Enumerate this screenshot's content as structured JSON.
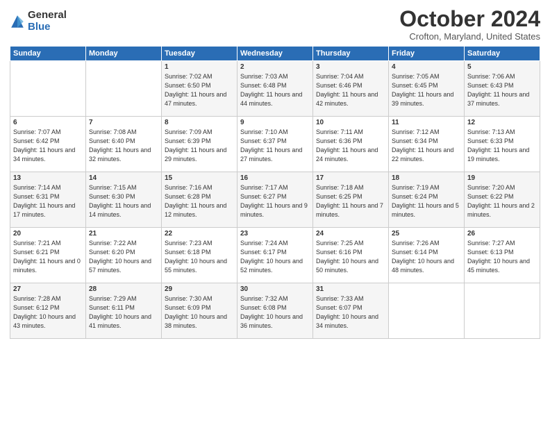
{
  "logo": {
    "general": "General",
    "blue": "Blue"
  },
  "header": {
    "month": "October 2024",
    "location": "Crofton, Maryland, United States"
  },
  "days_of_week": [
    "Sunday",
    "Monday",
    "Tuesday",
    "Wednesday",
    "Thursday",
    "Friday",
    "Saturday"
  ],
  "weeks": [
    [
      {
        "day": "",
        "content": ""
      },
      {
        "day": "",
        "content": ""
      },
      {
        "day": "1",
        "content": "Sunrise: 7:02 AM\nSunset: 6:50 PM\nDaylight: 11 hours and 47 minutes."
      },
      {
        "day": "2",
        "content": "Sunrise: 7:03 AM\nSunset: 6:48 PM\nDaylight: 11 hours and 44 minutes."
      },
      {
        "day": "3",
        "content": "Sunrise: 7:04 AM\nSunset: 6:46 PM\nDaylight: 11 hours and 42 minutes."
      },
      {
        "day": "4",
        "content": "Sunrise: 7:05 AM\nSunset: 6:45 PM\nDaylight: 11 hours and 39 minutes."
      },
      {
        "day": "5",
        "content": "Sunrise: 7:06 AM\nSunset: 6:43 PM\nDaylight: 11 hours and 37 minutes."
      }
    ],
    [
      {
        "day": "6",
        "content": "Sunrise: 7:07 AM\nSunset: 6:42 PM\nDaylight: 11 hours and 34 minutes."
      },
      {
        "day": "7",
        "content": "Sunrise: 7:08 AM\nSunset: 6:40 PM\nDaylight: 11 hours and 32 minutes."
      },
      {
        "day": "8",
        "content": "Sunrise: 7:09 AM\nSunset: 6:39 PM\nDaylight: 11 hours and 29 minutes."
      },
      {
        "day": "9",
        "content": "Sunrise: 7:10 AM\nSunset: 6:37 PM\nDaylight: 11 hours and 27 minutes."
      },
      {
        "day": "10",
        "content": "Sunrise: 7:11 AM\nSunset: 6:36 PM\nDaylight: 11 hours and 24 minutes."
      },
      {
        "day": "11",
        "content": "Sunrise: 7:12 AM\nSunset: 6:34 PM\nDaylight: 11 hours and 22 minutes."
      },
      {
        "day": "12",
        "content": "Sunrise: 7:13 AM\nSunset: 6:33 PM\nDaylight: 11 hours and 19 minutes."
      }
    ],
    [
      {
        "day": "13",
        "content": "Sunrise: 7:14 AM\nSunset: 6:31 PM\nDaylight: 11 hours and 17 minutes."
      },
      {
        "day": "14",
        "content": "Sunrise: 7:15 AM\nSunset: 6:30 PM\nDaylight: 11 hours and 14 minutes."
      },
      {
        "day": "15",
        "content": "Sunrise: 7:16 AM\nSunset: 6:28 PM\nDaylight: 11 hours and 12 minutes."
      },
      {
        "day": "16",
        "content": "Sunrise: 7:17 AM\nSunset: 6:27 PM\nDaylight: 11 hours and 9 minutes."
      },
      {
        "day": "17",
        "content": "Sunrise: 7:18 AM\nSunset: 6:25 PM\nDaylight: 11 hours and 7 minutes."
      },
      {
        "day": "18",
        "content": "Sunrise: 7:19 AM\nSunset: 6:24 PM\nDaylight: 11 hours and 5 minutes."
      },
      {
        "day": "19",
        "content": "Sunrise: 7:20 AM\nSunset: 6:22 PM\nDaylight: 11 hours and 2 minutes."
      }
    ],
    [
      {
        "day": "20",
        "content": "Sunrise: 7:21 AM\nSunset: 6:21 PM\nDaylight: 11 hours and 0 minutes."
      },
      {
        "day": "21",
        "content": "Sunrise: 7:22 AM\nSunset: 6:20 PM\nDaylight: 10 hours and 57 minutes."
      },
      {
        "day": "22",
        "content": "Sunrise: 7:23 AM\nSunset: 6:18 PM\nDaylight: 10 hours and 55 minutes."
      },
      {
        "day": "23",
        "content": "Sunrise: 7:24 AM\nSunset: 6:17 PM\nDaylight: 10 hours and 52 minutes."
      },
      {
        "day": "24",
        "content": "Sunrise: 7:25 AM\nSunset: 6:16 PM\nDaylight: 10 hours and 50 minutes."
      },
      {
        "day": "25",
        "content": "Sunrise: 7:26 AM\nSunset: 6:14 PM\nDaylight: 10 hours and 48 minutes."
      },
      {
        "day": "26",
        "content": "Sunrise: 7:27 AM\nSunset: 6:13 PM\nDaylight: 10 hours and 45 minutes."
      }
    ],
    [
      {
        "day": "27",
        "content": "Sunrise: 7:28 AM\nSunset: 6:12 PM\nDaylight: 10 hours and 43 minutes."
      },
      {
        "day": "28",
        "content": "Sunrise: 7:29 AM\nSunset: 6:11 PM\nDaylight: 10 hours and 41 minutes."
      },
      {
        "day": "29",
        "content": "Sunrise: 7:30 AM\nSunset: 6:09 PM\nDaylight: 10 hours and 38 minutes."
      },
      {
        "day": "30",
        "content": "Sunrise: 7:32 AM\nSunset: 6:08 PM\nDaylight: 10 hours and 36 minutes."
      },
      {
        "day": "31",
        "content": "Sunrise: 7:33 AM\nSunset: 6:07 PM\nDaylight: 10 hours and 34 minutes."
      },
      {
        "day": "",
        "content": ""
      },
      {
        "day": "",
        "content": ""
      }
    ]
  ]
}
